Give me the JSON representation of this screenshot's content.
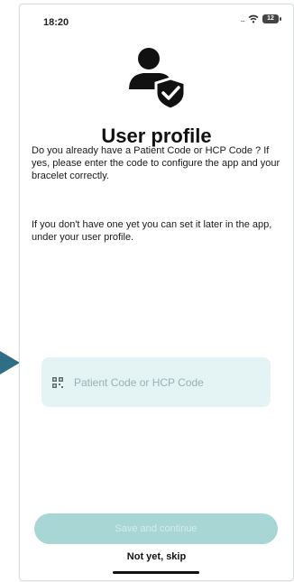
{
  "status_bar": {
    "time": "18:20",
    "signal": "...",
    "battery": "12"
  },
  "page": {
    "title": "User profile",
    "intro_text": "Do you already have a Patient Code or HCP Code ? If yes, please enter the code to configure the app and your bracelet correctly.",
    "later_text": "If you don't have one yet you can set it later in the app, under your user profile."
  },
  "form": {
    "code_placeholder": "Patient Code or HCP Code",
    "code_value": ""
  },
  "actions": {
    "save_label": "Save and continue",
    "skip_label": "Not yet, skip"
  },
  "colors": {
    "accent": "#a7d6d5",
    "input_bg": "#e4f3f3",
    "pointer": "#2f6f86"
  },
  "icons": [
    "user-shield-icon",
    "qr-code-icon",
    "wifi-icon",
    "battery-icon",
    "pointer-arrow-icon"
  ]
}
